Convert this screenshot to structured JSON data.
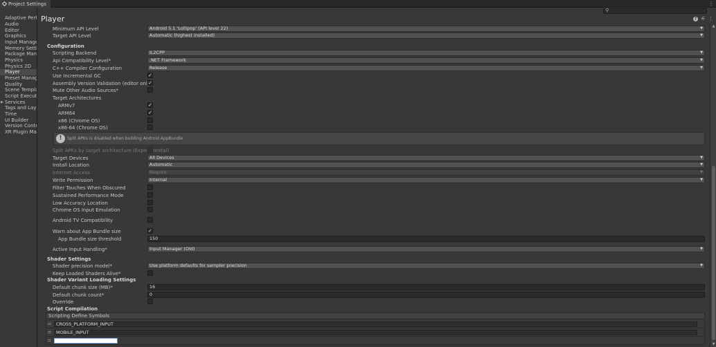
{
  "window": {
    "tab_title": "Project Settings",
    "page_title": "Player",
    "search": {
      "placeholder": "",
      "value": ""
    }
  },
  "sidebar": {
    "items": [
      {
        "label": "Adaptive Performance",
        "selected": false,
        "expandable": false
      },
      {
        "label": "Audio",
        "selected": false,
        "expandable": false
      },
      {
        "label": "Editor",
        "selected": false,
        "expandable": false
      },
      {
        "label": "Graphics",
        "selected": false,
        "expandable": false
      },
      {
        "label": "Input Manager",
        "selected": false,
        "expandable": false
      },
      {
        "label": "Memory Settings",
        "selected": false,
        "expandable": false
      },
      {
        "label": "Package Manager",
        "selected": false,
        "expandable": false
      },
      {
        "label": "Physics",
        "selected": false,
        "expandable": false
      },
      {
        "label": "Physics 2D",
        "selected": false,
        "expandable": false
      },
      {
        "label": "Player",
        "selected": true,
        "expandable": false
      },
      {
        "label": "Preset Manager",
        "selected": false,
        "expandable": false
      },
      {
        "label": "Quality",
        "selected": false,
        "expandable": false
      },
      {
        "label": "Scene Template",
        "selected": false,
        "expandable": false
      },
      {
        "label": "Script Execution Order",
        "selected": false,
        "expandable": false
      },
      {
        "label": "Services",
        "selected": false,
        "expandable": true
      },
      {
        "label": "Tags and Layers",
        "selected": false,
        "expandable": false
      },
      {
        "label": "Time",
        "selected": false,
        "expandable": false
      },
      {
        "label": "UI Builder",
        "selected": false,
        "expandable": false
      },
      {
        "label": "Version Control",
        "selected": false,
        "expandable": false
      },
      {
        "label": "XR Plugin Management",
        "selected": false,
        "expandable": false
      }
    ]
  },
  "settings": {
    "min_api": {
      "label": "Minimum API Level",
      "value": "Android 5.1 'Lollipop' (API level 22)"
    },
    "target_api": {
      "label": "Target API Level",
      "value": "Automatic (highest installed)"
    },
    "configuration_header": "Configuration",
    "scripting_backend": {
      "label": "Scripting Backend",
      "value": "IL2CPP"
    },
    "api_compat": {
      "label": "Api Compatibility Level*",
      "value": ".NET Framework"
    },
    "cpp_compiler": {
      "label": "C++ Compiler Configuration",
      "value": "Release"
    },
    "incremental_gc": {
      "label": "Use Incremental GC",
      "checked": true
    },
    "assembly_validation": {
      "label": "Assembly Version Validation (editor only)",
      "checked": true
    },
    "mute_audio": {
      "label": "Mute Other Audio Sources*",
      "checked": false
    },
    "target_arch": {
      "label": "Target Architectures"
    },
    "armv7": {
      "label": "ARMv7",
      "checked": true
    },
    "arm64": {
      "label": "ARM64",
      "checked": true
    },
    "x86": {
      "label": "x86 (Chrome OS)",
      "checked": false
    },
    "x86_64": {
      "label": "x86-64 (Chrome OS)",
      "checked": false
    },
    "split_apk_notice": "Split APKs is disabled when building Android AppBundle",
    "split_apk": {
      "label": "Split APKs by target architecture (Experimental)",
      "checked": false
    },
    "target_devices": {
      "label": "Target Devices",
      "value": "All Devices"
    },
    "install_location": {
      "label": "Install Location",
      "value": "Automatic"
    },
    "internet_access": {
      "label": "Internet Access",
      "value": "Require"
    },
    "write_permission": {
      "label": "Write Permission",
      "value": "Internal"
    },
    "filter_touches": {
      "label": "Filter Touches When Obscured",
      "checked": false
    },
    "sustained_perf": {
      "label": "Sustained Performance Mode",
      "checked": false
    },
    "low_accuracy": {
      "label": "Low Accuracy Location",
      "checked": false
    },
    "chrome_os_input": {
      "label": "Chrome OS Input Emulation",
      "checked": false
    },
    "android_tv": {
      "label": "Android TV Compatibility",
      "checked": false
    },
    "warn_bundle": {
      "label": "Warn about App Bundle size",
      "checked": true
    },
    "bundle_threshold": {
      "label": "App Bundle size threshold",
      "value": "150"
    },
    "active_input": {
      "label": "Active Input Handling*",
      "value": "Input Manager (Old)"
    },
    "shader_settings_header": "Shader Settings",
    "shader_precision": {
      "label": "Shader precision model*",
      "value": "Use platform defaults for sampler precision"
    },
    "keep_shaders": {
      "label": "Keep Loaded Shaders Alive*",
      "checked": false
    },
    "shader_variant_header": "Shader Variant Loading Settings",
    "default_chunk_size": {
      "label": "Default chunk size (MB)*",
      "value": "16"
    },
    "default_chunk_count": {
      "label": "Default chunk count*",
      "value": "0"
    },
    "override": {
      "label": "Override",
      "checked": false
    },
    "script_compilation_header": "Script Compilation",
    "define_symbols": {
      "label": "Scripting Define Symbols",
      "items": [
        "CROSS_PLATFORM_INPUT",
        "MOBILE_INPUT",
        ""
      ]
    }
  },
  "icons": {
    "tab": "gear-icon",
    "window_menu": "kebab-menu-icon",
    "search": "search-icon",
    "help": "help-icon",
    "presets": "sliders-icon",
    "more": "kebab-menu-icon"
  }
}
